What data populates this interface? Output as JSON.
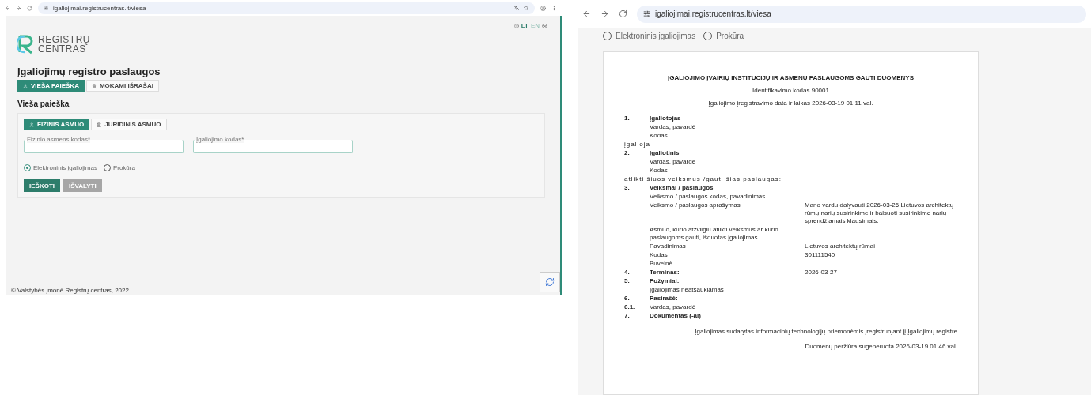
{
  "left_window": {
    "url": "igaliojimai.registrucentras.lt/viesa",
    "languages": [
      {
        "label": "LT",
        "selected": true
      },
      {
        "label": "EN",
        "selected": false
      }
    ],
    "logo": [
      "REGISTRŲ",
      "CENTRAS"
    ],
    "title": "Įgaliojimų registro paslaugos",
    "service_tabs": [
      {
        "label": "VIEŠA PAIEŠKA",
        "selected": true,
        "kind": "person"
      },
      {
        "label": "MOKAMI IŠRAŠAI",
        "selected": false,
        "kind": "building"
      }
    ],
    "section_title": "Vieša paieška",
    "person_tabs": [
      {
        "label": "FIZINIS ASMUO",
        "selected": true,
        "kind": "person"
      },
      {
        "label": "JURIDINIS ASMUO",
        "selected": false,
        "kind": "building"
      }
    ],
    "fields": [
      {
        "label": "Fizinio asmens kodas*"
      },
      {
        "label": "Įgaliojimo kodas*"
      }
    ],
    "radios": [
      {
        "label": "Elektroninis įgaliojimas",
        "selected": true
      },
      {
        "label": "Prokūra",
        "selected": false
      }
    ],
    "buttons": [
      {
        "label": "IEŠKOTI",
        "disabled": false
      },
      {
        "label": "IŠVALYTI",
        "disabled": true
      }
    ],
    "footer": "© Valstybės įmonė Registrų centras, 2022"
  },
  "right_window": {
    "url": "igaliojimai.registrucentras.lt/viesa",
    "radios": [
      {
        "label": "Elektroninis įgaliojimas",
        "selected": false
      },
      {
        "label": "Prokūra",
        "selected": false
      }
    ],
    "document": {
      "title": "ĮGALIOJIMO ĮVAIRIŲ INSTITUCIJŲ IR ASMENŲ PASLAUGOMS GAUTI DUOMENYS",
      "id_line": "Identifikavimo kodas 90001",
      "date_line": "Įgaliojimo įregistravimo data ir laikas 2026-03-19 01:11 val.",
      "rows": [
        {
          "kind": "heading",
          "number": "1.",
          "label": "Įgaliotojas"
        },
        {
          "kind": "field",
          "label": "Vardas, pavardė"
        },
        {
          "kind": "field",
          "label": "Kodas"
        },
        {
          "kind": "interlude",
          "label": "įgalioja"
        },
        {
          "kind": "heading",
          "number": "2.",
          "label": "Įgaliotinis"
        },
        {
          "kind": "field",
          "label": "Vardas, pavardė"
        },
        {
          "kind": "field",
          "label": "Kodas"
        },
        {
          "kind": "interlude",
          "label": "atlikti šiuos veiksmus /gauti šias paslaugas:"
        },
        {
          "kind": "heading",
          "number": "3.",
          "label": "Veiksmai / paslaugos"
        },
        {
          "kind": "field",
          "label": "Veiksmo / paslaugos kodas, pavadinimas"
        },
        {
          "kind": "field",
          "label": "Veiksmo / paslaugos aprašymas",
          "value": "Mano vardu dalyvauti 2026-03-26 Lietuvos architektų rūmų narių susirinkime ir balsuoti susirinkime narių sprendžiamais klausimais."
        },
        {
          "kind": "field",
          "label": "Asmuo, kurio atžvilgiu atlikti veiksmus ar kurio paslaugoms gauti, išduotas įgaliojimas"
        },
        {
          "kind": "field",
          "label": "Pavadinimas",
          "value": "Lietuvos architektų rūmai"
        },
        {
          "kind": "field",
          "label": "Kodas",
          "value": "301111540"
        },
        {
          "kind": "field",
          "label": "Buveinė"
        },
        {
          "kind": "heading",
          "number": "4.",
          "label": "Terminas:",
          "value": "2026-03-27"
        },
        {
          "kind": "heading",
          "number": "5.",
          "label": "Požymiai:"
        },
        {
          "kind": "field",
          "label": "Įgaliojimas neatšaukiamas"
        },
        {
          "kind": "heading",
          "number": "6.",
          "label": "Pasirašė:"
        },
        {
          "kind": "subitem",
          "number": "6.1.",
          "label": "Vardas, pavardė"
        },
        {
          "kind": "heading",
          "number": "7.",
          "label": "Dokumentas (-ai)"
        }
      ],
      "footer_lines": [
        "Įgaliojimas sudarytas informacinių technologijų priemonėmis įregistruojant jį Įgaliojimų registre",
        "Duomenų peržiūra sugeneruota 2026-03-19 01:46 val."
      ]
    }
  }
}
